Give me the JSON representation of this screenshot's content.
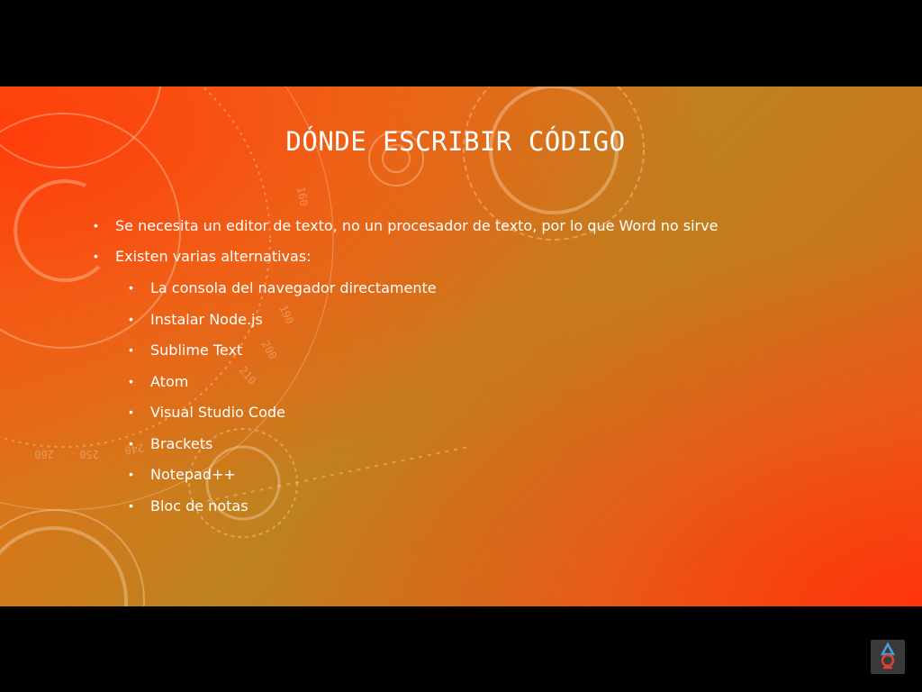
{
  "slide": {
    "title": "DÓNDE ESCRIBIR CÓDIGO",
    "bullets": [
      {
        "text": "Se necesita un editor de texto, no un procesador de texto, por lo que Word no sirve",
        "level": 1
      },
      {
        "text": "Existen varias alternativas:",
        "level": 1
      },
      {
        "text": "La consola del navegador directamente",
        "level": 2
      },
      {
        "text": "Instalar Node.js",
        "level": 2
      },
      {
        "text": "Sublime Text",
        "level": 2
      },
      {
        "text": "Atom",
        "level": 2
      },
      {
        "text": "Visual Studio Code",
        "level": 2
      },
      {
        "text": "Brackets",
        "level": 2
      },
      {
        "text": "Notepad++",
        "level": 2
      },
      {
        "text": "Bloc de notas",
        "level": 2
      }
    ],
    "bullet_glyph": "•",
    "background_decor_numbers": [
      "140",
      "160",
      "190",
      "200",
      "210",
      "240",
      "250",
      "260"
    ]
  },
  "overlay": {
    "logo_icon": "delta-omega-logo-icon"
  },
  "colors": {
    "text": "#ffffff",
    "letterbox": "#000000",
    "bg_warm": "#f25a12",
    "bg_olive": "#bf811f"
  }
}
